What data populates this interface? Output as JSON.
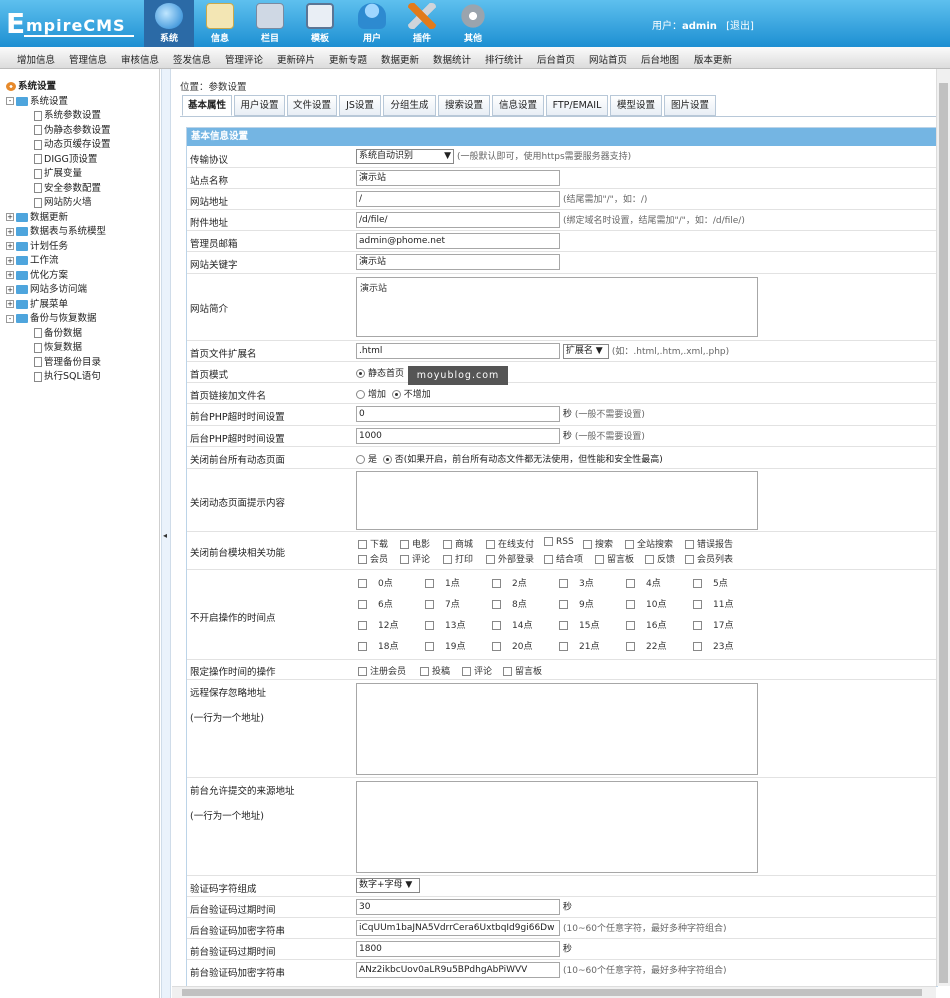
{
  "app": {
    "logo_letter": "E",
    "logo_rest": "mpireCMS"
  },
  "topnav": [
    {
      "label": "系统",
      "icon": "globe-icon",
      "active": true
    },
    {
      "label": "信息",
      "icon": "notepad-icon"
    },
    {
      "label": "栏目",
      "icon": "folder-icon"
    },
    {
      "label": "模板",
      "icon": "window-icon"
    },
    {
      "label": "用户",
      "icon": "user-icon"
    },
    {
      "label": "插件",
      "icon": "tools-icon"
    },
    {
      "label": "其他",
      "icon": "gear-icon"
    }
  ],
  "user": {
    "prefix": "用户：",
    "name": "admin",
    "logout": "[退出]"
  },
  "menubar": [
    "增加信息",
    "管理信息",
    "审核信息",
    "签发信息",
    "管理评论",
    "更新碎片",
    "更新专题",
    "数据更新",
    "数据统计",
    "排行统计",
    "后台首页",
    "网站首页",
    "后台地图",
    "版本更新"
  ],
  "tree": [
    {
      "t": "系统设置",
      "lvl": 0,
      "kind": "root"
    },
    {
      "t": "系统设置",
      "lvl": 1,
      "kind": "folder",
      "pm": "-"
    },
    {
      "t": "系统参数设置",
      "lvl": 2,
      "kind": "page"
    },
    {
      "t": "伪静态参数设置",
      "lvl": 2,
      "kind": "page"
    },
    {
      "t": "动态页缓存设置",
      "lvl": 2,
      "kind": "page"
    },
    {
      "t": "DIGG顶设置",
      "lvl": 2,
      "kind": "page"
    },
    {
      "t": "扩展变量",
      "lvl": 2,
      "kind": "page"
    },
    {
      "t": "安全参数配置",
      "lvl": 2,
      "kind": "page"
    },
    {
      "t": "网站防火墙",
      "lvl": 2,
      "kind": "page"
    },
    {
      "t": "数据更新",
      "lvl": 1,
      "kind": "folder",
      "pm": "+"
    },
    {
      "t": "数据表与系统模型",
      "lvl": 1,
      "kind": "folder",
      "pm": "+"
    },
    {
      "t": "计划任务",
      "lvl": 1,
      "kind": "folder",
      "pm": "+"
    },
    {
      "t": "工作流",
      "lvl": 1,
      "kind": "folder",
      "pm": "+"
    },
    {
      "t": "优化方案",
      "lvl": 1,
      "kind": "folder",
      "pm": "+"
    },
    {
      "t": "网站多访问端",
      "lvl": 1,
      "kind": "folder",
      "pm": "+"
    },
    {
      "t": "扩展菜单",
      "lvl": 1,
      "kind": "folder",
      "pm": "+"
    },
    {
      "t": "备份与恢复数据",
      "lvl": 1,
      "kind": "folder",
      "pm": "-"
    },
    {
      "t": "备份数据",
      "lvl": 2,
      "kind": "page"
    },
    {
      "t": "恢复数据",
      "lvl": 2,
      "kind": "page"
    },
    {
      "t": "管理备份目录",
      "lvl": 2,
      "kind": "page"
    },
    {
      "t": "执行SQL语句",
      "lvl": 2,
      "kind": "page"
    }
  ],
  "breadcrumb": "位置：参数设置",
  "tabs": [
    "基本属性",
    "用户设置",
    "文件设置",
    "JS设置",
    "分组生成",
    "搜索设置",
    "信息设置",
    "FTP/EMAIL",
    "模型设置",
    "图片设置"
  ],
  "form": {
    "header": "基本信息设置",
    "protocol": {
      "label": "传输协议",
      "value": "系统自动识别",
      "hint": "(一般默认即可，使用https需要服务器支持)"
    },
    "sitename": {
      "label": "站点名称",
      "value": "演示站"
    },
    "siteurl": {
      "label": "网站地址",
      "value": "/",
      "hint": "(结尾需加\"/\"，如：/)"
    },
    "attachurl": {
      "label": "附件地址",
      "value": "/d/file/",
      "hint": "(绑定域名时设置，结尾需加\"/\"，如：/d/file/)"
    },
    "email": {
      "label": "管理员邮箱",
      "value": "admin@phome.net"
    },
    "keywords": {
      "label": "网站关键字",
      "value": "演示站"
    },
    "intro": {
      "label": "网站简介",
      "value": "演示站"
    },
    "ext": {
      "label": "首页文件扩展名",
      "value": ".html",
      "select": "扩展名",
      "hint": "(如：.html,.htm,.xml,.php)"
    },
    "homemode": {
      "label": "首页模式",
      "opt1": "静态首页"
    },
    "homelink": {
      "label": "首页链接加文件名",
      "opt1": "增加",
      "opt2": "不增加"
    },
    "phptimeout": {
      "label": "前台PHP超时时间设置",
      "value": "0",
      "unit": "秒",
      "hint": "(一般不需要设置)"
    },
    "admintimeout": {
      "label": "后台PHP超时时间设置",
      "value": "1000",
      "unit": "秒",
      "hint": "(一般不需要设置)"
    },
    "closedyn": {
      "label": "关闭前台所有动态页面",
      "opt1": "是",
      "opt2": "否",
      "hint": "(如果开启，前台所有动态文件都无法使用，但性能和安全性最高)"
    },
    "closemsg": {
      "label": "关闭动态页面提示内容"
    },
    "closemods": {
      "label": "关闭前台模块相关功能",
      "row1": [
        "下载",
        "电影",
        "商城",
        "在线支付",
        "RSS",
        "搜索",
        "全站搜索",
        "错误报告"
      ],
      "row2": [
        "会员",
        "评论",
        "打印",
        "外部登录",
        "结合项",
        "留言板",
        "反馈",
        "会员列表"
      ]
    },
    "hours": {
      "label": "不开启操作的时间点",
      "items": [
        "0点",
        "1点",
        "2点",
        "3点",
        "4点",
        "5点",
        "6点",
        "7点",
        "8点",
        "9点",
        "10点",
        "11点",
        "12点",
        "13点",
        "14点",
        "15点",
        "16点",
        "17点",
        "18点",
        "19点",
        "20点",
        "21点",
        "22点",
        "23点"
      ]
    },
    "limitops": {
      "label": "限定操作时间的操作",
      "items": [
        "注册会员",
        "投稿",
        "评论",
        "留言板"
      ]
    },
    "remoteignore": {
      "label": "远程保存忽略地址",
      "sub": "(一行为一个地址)"
    },
    "allowsrc": {
      "label": "前台允许提交的来源地址",
      "sub": "(一行为一个地址)"
    },
    "captcha": {
      "label": "验证码字符组成",
      "value": "数字+字母"
    },
    "bexpire": {
      "label": "后台验证码过期时间",
      "value": "30",
      "unit": "秒"
    },
    "bkey": {
      "label": "后台验证码加密字符串",
      "value": "iCqUUm1baJNA5VdrrCera6UxtbqId9gi66Dw",
      "hint": "(10~60个任意字符，最好多种字符组合)"
    },
    "fexpire": {
      "label": "前台验证码过期时间",
      "value": "1800",
      "unit": "秒"
    },
    "fkey": {
      "label": "前台验证码加密字符串",
      "value": "ANz2ikbcUov0aLR9u5BPdhgAbPiWVV",
      "hint": "(10~60个任意字符，最好多种字符组合)"
    }
  },
  "watermark": "moyublog.com",
  "colors": {
    "topbar": "#1d8fd2",
    "formhead": "#74b5e3"
  }
}
